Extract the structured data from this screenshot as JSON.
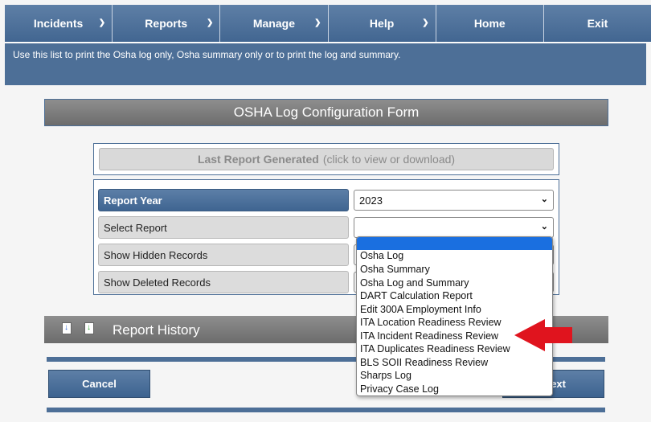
{
  "nav": {
    "items": [
      {
        "label": "Incidents",
        "caret": true
      },
      {
        "label": "Reports",
        "caret": true
      },
      {
        "label": "Manage",
        "caret": true
      },
      {
        "label": "Help",
        "caret": true
      },
      {
        "label": "Home",
        "caret": false
      },
      {
        "label": "Exit",
        "caret": false
      }
    ]
  },
  "info": {
    "text": "Use this list to print the Osha log only, Osha summary only or to print the log and summary."
  },
  "form": {
    "title": "OSHA Log Configuration Form",
    "last_report": {
      "bold": "Last Report Generated",
      "hint": "(click to view or download)"
    },
    "rows": [
      {
        "label": "Report Year",
        "value": "2023"
      },
      {
        "label": "Select Report",
        "value": ""
      },
      {
        "label": "Show Hidden Records"
      },
      {
        "label": "Show Deleted Records"
      }
    ],
    "report_options": [
      "",
      "Osha Log",
      "Osha Summary",
      "Osha Log and Summary",
      "DART Calculation Report",
      "Edit 300A Employment Info",
      "ITA Location Readiness Review",
      "ITA Incident Readiness Review",
      "ITA Duplicates Readiness Review",
      "BLS SOII Readiness Review",
      "Sharps Log",
      "Privacy Case Log"
    ]
  },
  "history": {
    "label": "Report History"
  },
  "buttons": {
    "cancel": "Cancel",
    "next_partial": "ext"
  },
  "colors": {
    "nav_bg": "#4d6f97",
    "title_bg": "#7d7d7d",
    "highlight": "#1a6fe0",
    "annotation_arrow": "#e0141e"
  }
}
